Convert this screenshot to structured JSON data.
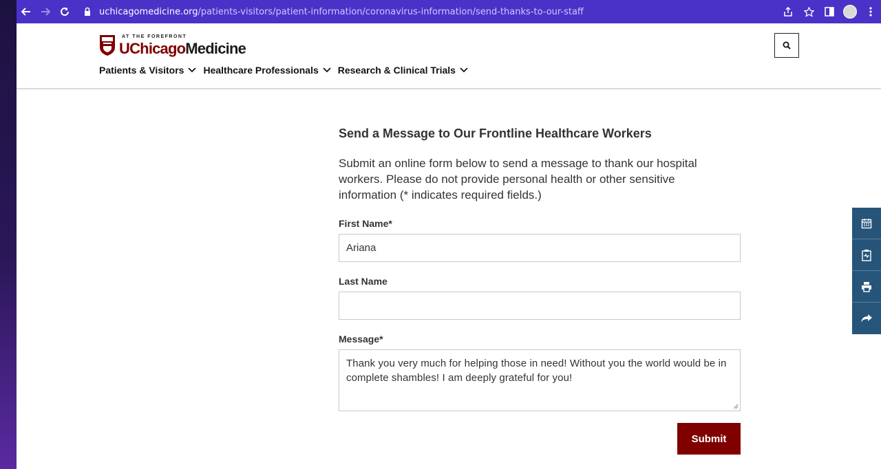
{
  "browser": {
    "url_host": "uchicagomedicine.org",
    "url_path": "/patients-visitors/patient-information/coronavirus-information/send-thanks-to-our-staff"
  },
  "site": {
    "logo_tagline": "AT THE FOREFRONT",
    "logo_u": "UChicago",
    "logo_m": "Medicine",
    "nav": [
      "Patients & Visitors",
      "Healthcare Professionals",
      "Research & Clinical Trials"
    ]
  },
  "form": {
    "title": "Send a Message to Our Frontline Healthcare Workers",
    "intro": "Submit an online form below to send a message to thank our hospital workers. Please do not provide personal health or other sensitive information (* indicates required fields.)",
    "first_name_label": "First Name*",
    "first_name_value": "Ariana",
    "last_name_label": "Last Name",
    "last_name_value": "",
    "message_label": "Message*",
    "message_value": "Thank you very much for helping those in need! Without you the world would be in complete shambles! I am deeply grateful for you!",
    "submit_label": "Submit"
  },
  "colors": {
    "brand": "#800000",
    "browser_bar": "#4a32c8",
    "tool_bg": "#27557a"
  },
  "icons": {
    "tools": [
      "calendar-icon",
      "clipboard-health-icon",
      "print-icon",
      "share-icon"
    ]
  }
}
